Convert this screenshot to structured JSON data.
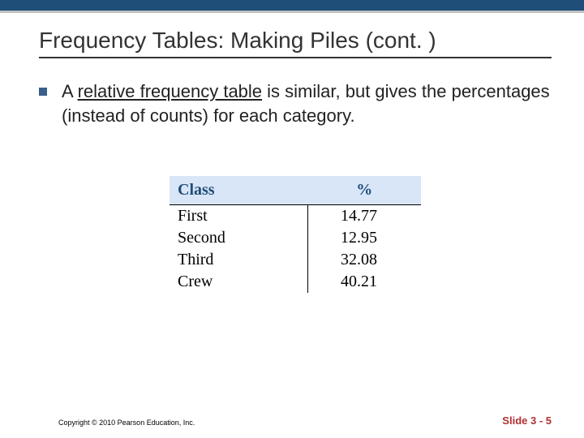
{
  "title": "Frequency Tables: Making Piles (cont. )",
  "bullet": {
    "prefix": "A ",
    "term": "relative frequency table",
    "rest": " is similar, but gives the percentages (instead of counts) for each category."
  },
  "chart_data": {
    "type": "table",
    "columns": [
      "Class",
      "%"
    ],
    "rows": [
      {
        "class": "First",
        "pct": "14.77"
      },
      {
        "class": "Second",
        "pct": "12.95"
      },
      {
        "class": "Third",
        "pct": "32.08"
      },
      {
        "class": "Crew",
        "pct": "40.21"
      }
    ]
  },
  "footer": {
    "copyright": "Copyright © 2010 Pearson Education, Inc.",
    "slide": "Slide 3 - 5"
  }
}
